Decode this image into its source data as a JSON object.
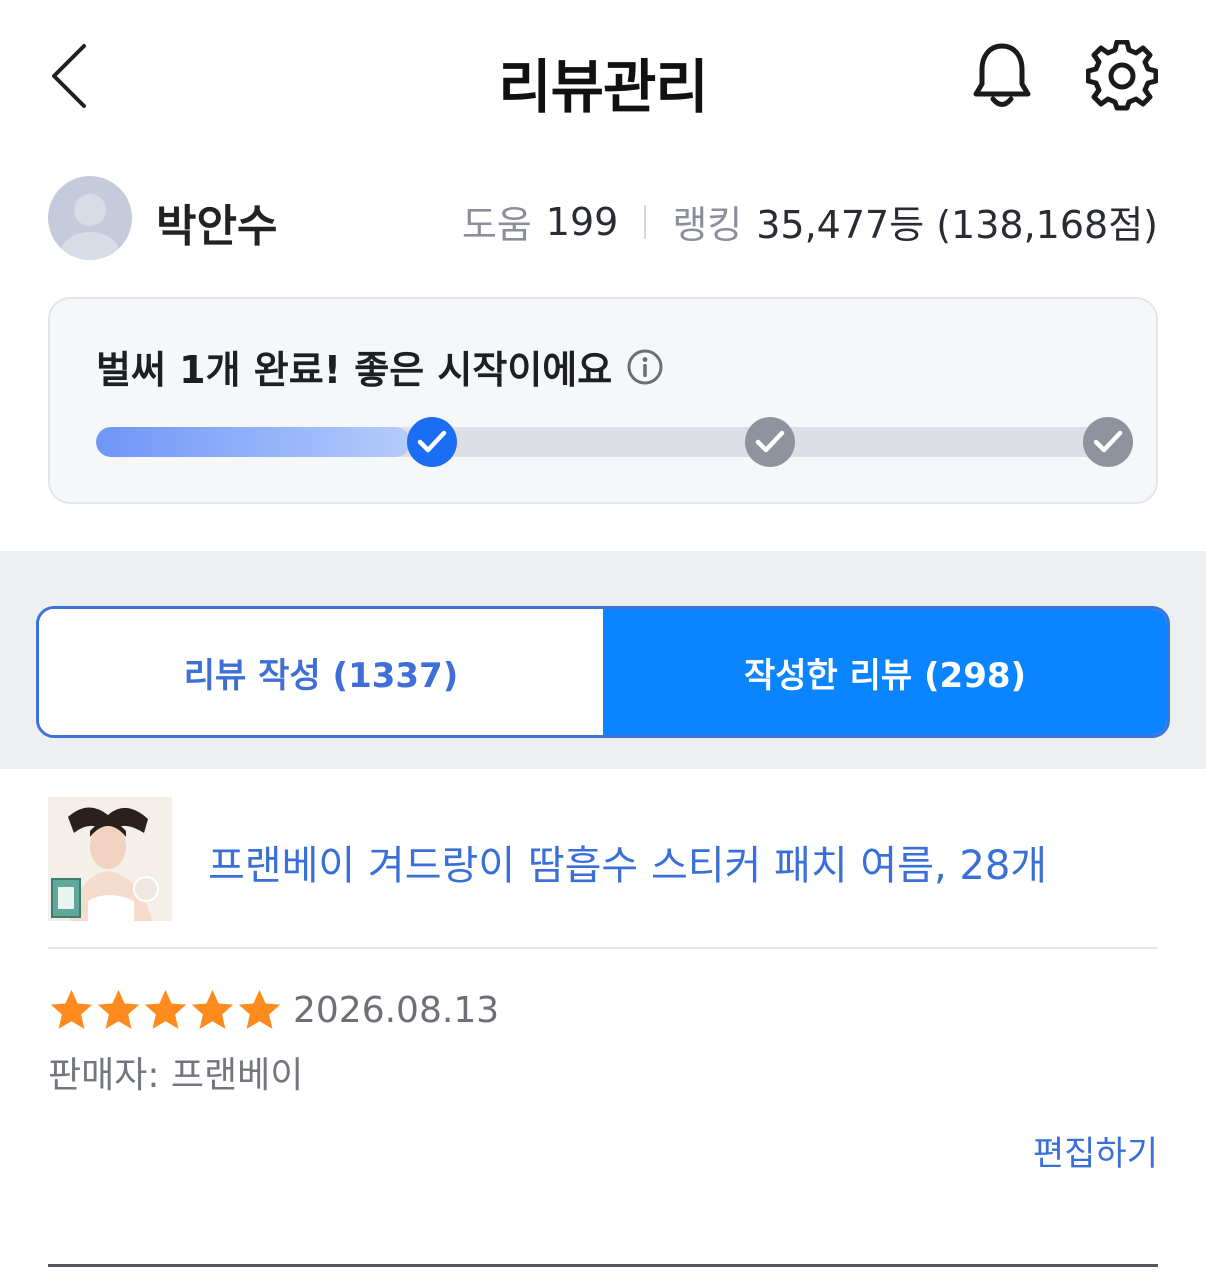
{
  "header": {
    "title": "리뷰관리",
    "back_icon": "chevron-left-icon",
    "notification_icon": "bell-icon",
    "settings_icon": "gear-icon"
  },
  "profile": {
    "name": "박안수",
    "help_label": "도움",
    "help_count": "199",
    "ranking_label": "랭킹",
    "ranking_value": "35,477등 (138,168점)"
  },
  "progress": {
    "title": "벌써 1개 완료! 좋은 시작이에요",
    "completed_milestones": 1,
    "total_milestones": 3,
    "fill_fraction": 0.31,
    "colors": {
      "done": "#1b6ef3",
      "todo": "#8f939d",
      "fill_start": "#6f96f8",
      "fill_end": "#b5cbfb"
    }
  },
  "tabs": [
    {
      "label": "리뷰 작성 (1337)",
      "active": false
    },
    {
      "label": "작성한 리뷰 (298)",
      "active": true
    }
  ],
  "review": {
    "product_name": "프랜베이 겨드랑이 땀흡수 스티커 패치 여름, 28개",
    "rating": 5,
    "max_rating": 5,
    "date": "2026.08.13",
    "seller": "판매자: 프랜베이",
    "edit_label": "편집하기",
    "star_color": "#ff8a1e"
  },
  "colors": {
    "accent": "#0a84ff",
    "link": "#3a6fd8"
  }
}
